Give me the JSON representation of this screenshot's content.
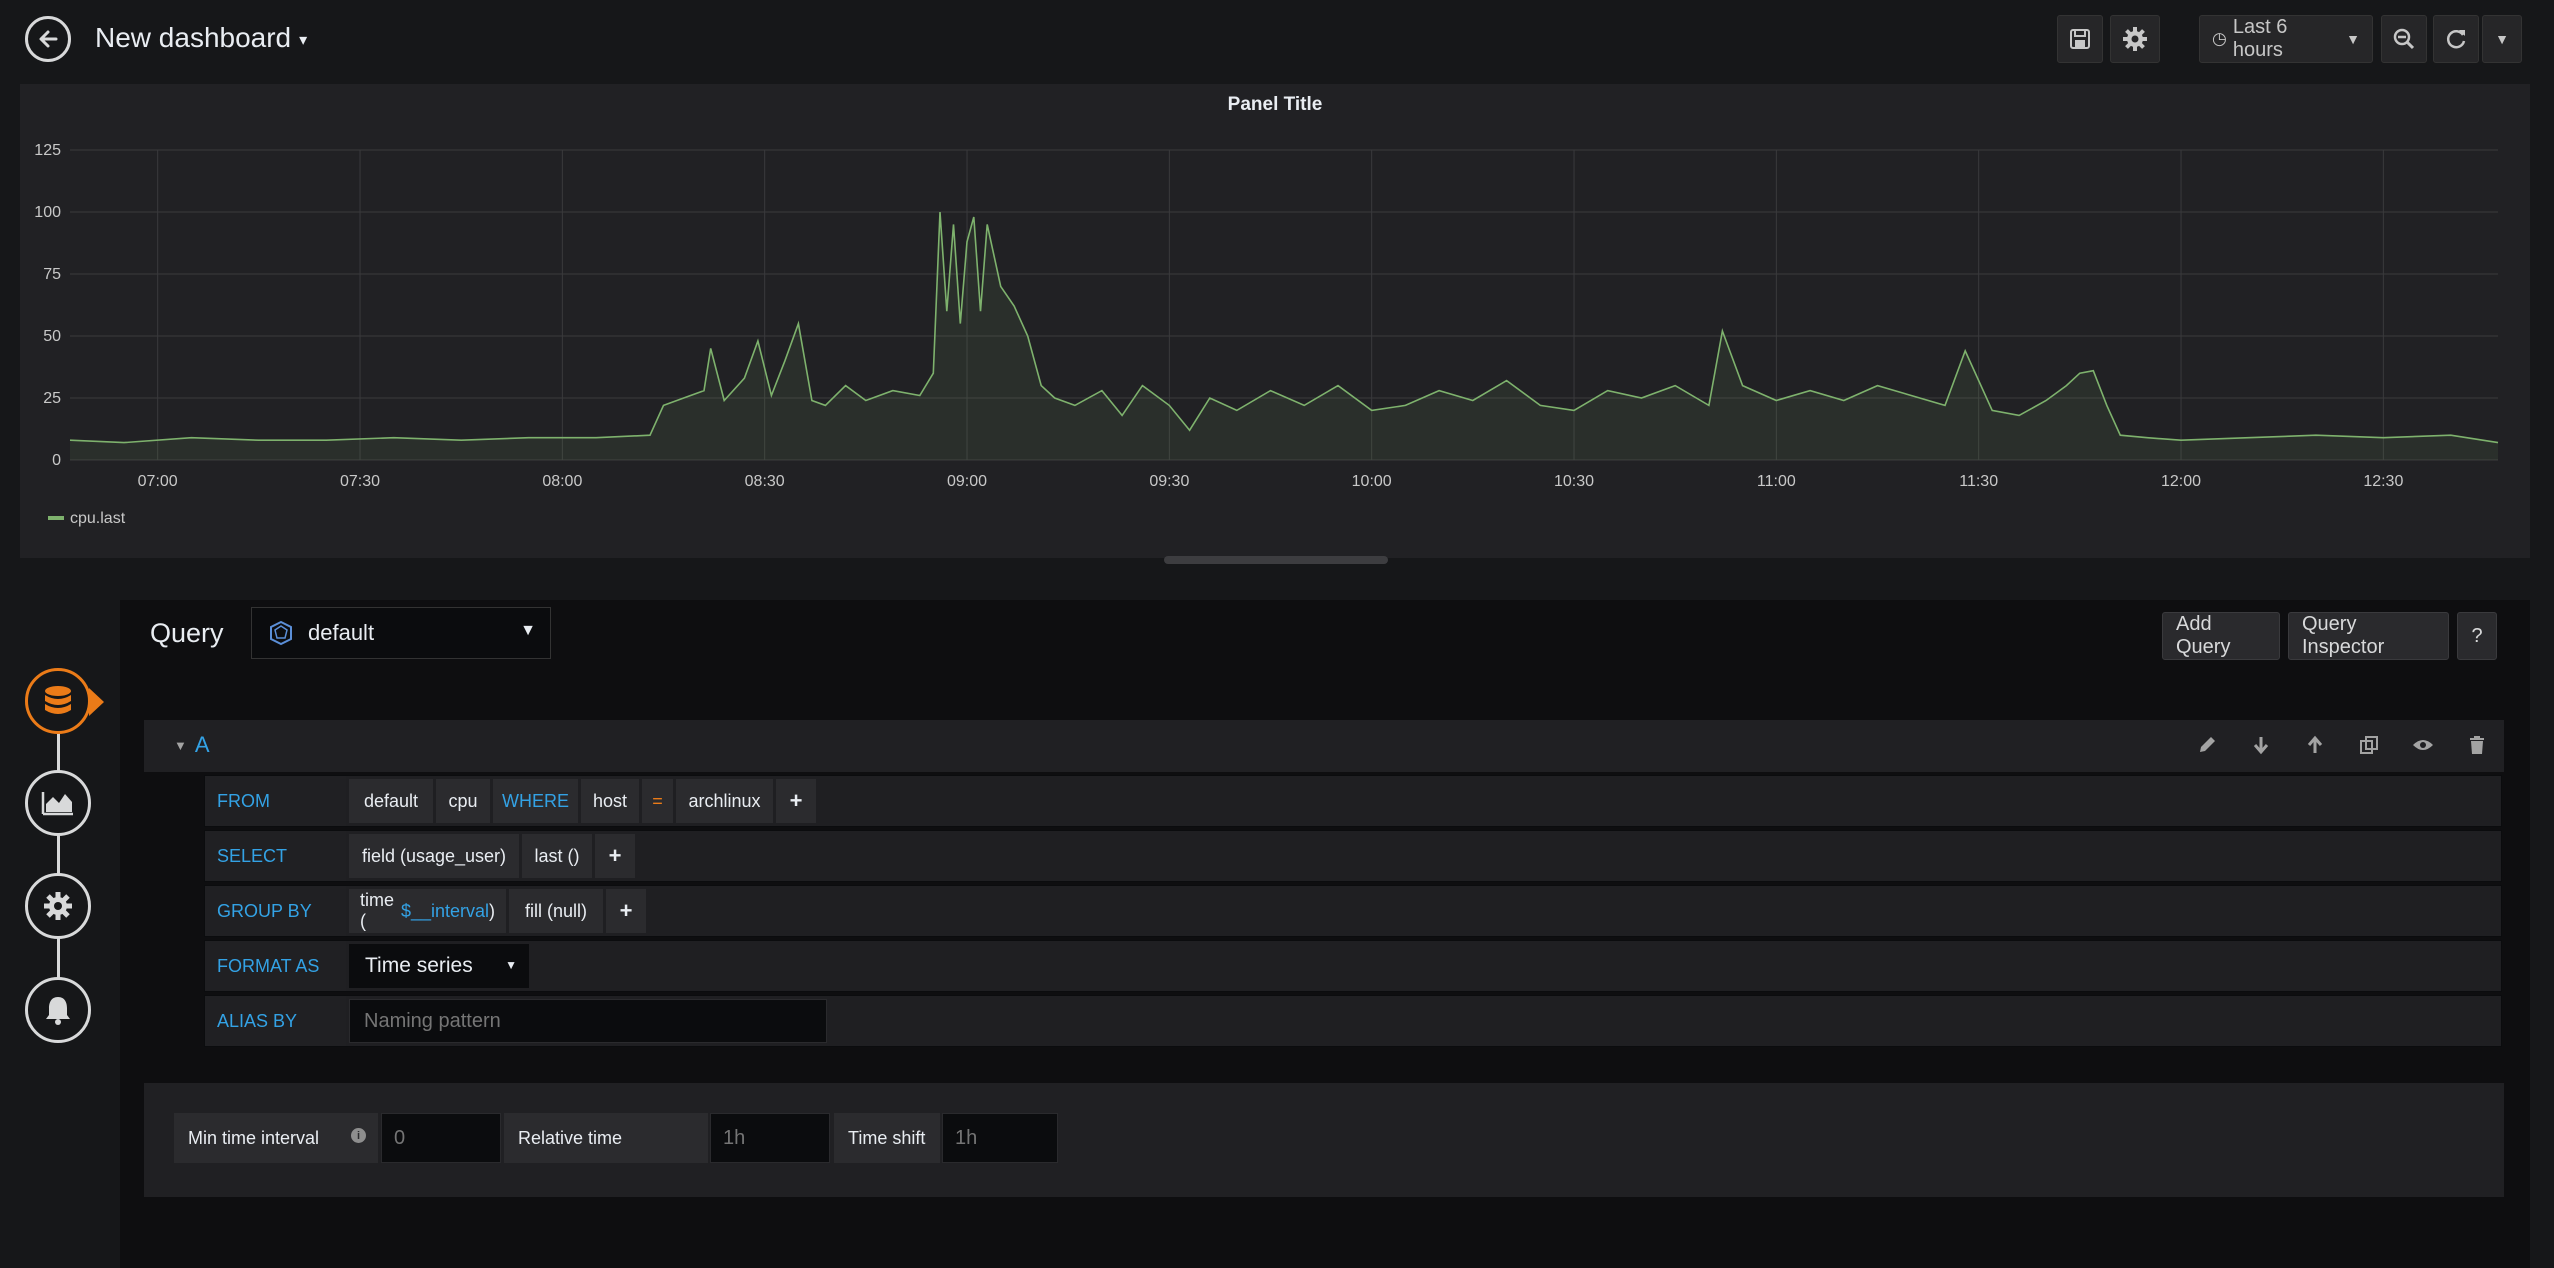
{
  "header": {
    "title": "New dashboard",
    "time_range": "Last 6 hours"
  },
  "panel": {
    "title": "Panel Title",
    "legend": "cpu.last"
  },
  "chart_data": {
    "type": "area",
    "title": "Panel Title",
    "xlabel": "",
    "ylabel": "",
    "x_ticks": [
      "07:00",
      "07:30",
      "08:00",
      "08:30",
      "09:00",
      "09:30",
      "10:00",
      "10:30",
      "11:00",
      "11:30",
      "12:00",
      "12:30"
    ],
    "y_ticks": [
      "125",
      "100",
      "75",
      "50",
      "25",
      "0"
    ],
    "ylim": [
      0,
      125
    ],
    "xlim": [
      "06:47",
      "12:47"
    ],
    "grid": true,
    "legend_position": "bottom-left",
    "series": [
      {
        "name": "cpu.last",
        "color": "#7eb26d",
        "points": [
          [
            "06:47",
            8
          ],
          [
            "06:55",
            7
          ],
          [
            "07:05",
            9
          ],
          [
            "07:15",
            8
          ],
          [
            "07:25",
            8
          ],
          [
            "07:35",
            9
          ],
          [
            "07:45",
            8
          ],
          [
            "07:55",
            9
          ],
          [
            "08:05",
            9
          ],
          [
            "08:13",
            10
          ],
          [
            "08:15",
            22
          ],
          [
            "08:18",
            25
          ],
          [
            "08:21",
            28
          ],
          [
            "08:22",
            45
          ],
          [
            "08:24",
            24
          ],
          [
            "08:27",
            33
          ],
          [
            "08:29",
            48
          ],
          [
            "08:31",
            26
          ],
          [
            "08:33",
            40
          ],
          [
            "08:35",
            55
          ],
          [
            "08:37",
            24
          ],
          [
            "08:39",
            22
          ],
          [
            "08:42",
            30
          ],
          [
            "08:45",
            24
          ],
          [
            "08:49",
            28
          ],
          [
            "08:53",
            26
          ],
          [
            "08:55",
            35
          ],
          [
            "08:56",
            100
          ],
          [
            "08:57",
            60
          ],
          [
            "08:58",
            95
          ],
          [
            "08:59",
            55
          ],
          [
            "09:00",
            88
          ],
          [
            "09:01",
            98
          ],
          [
            "09:02",
            60
          ],
          [
            "09:03",
            95
          ],
          [
            "09:05",
            70
          ],
          [
            "09:07",
            62
          ],
          [
            "09:09",
            50
          ],
          [
            "09:11",
            30
          ],
          [
            "09:13",
            25
          ],
          [
            "09:16",
            22
          ],
          [
            "09:20",
            28
          ],
          [
            "09:23",
            18
          ],
          [
            "09:26",
            30
          ],
          [
            "09:30",
            22
          ],
          [
            "09:33",
            12
          ],
          [
            "09:36",
            25
          ],
          [
            "09:40",
            20
          ],
          [
            "09:45",
            28
          ],
          [
            "09:50",
            22
          ],
          [
            "09:55",
            30
          ],
          [
            "10:00",
            20
          ],
          [
            "10:05",
            22
          ],
          [
            "10:10",
            28
          ],
          [
            "10:15",
            24
          ],
          [
            "10:20",
            32
          ],
          [
            "10:25",
            22
          ],
          [
            "10:30",
            20
          ],
          [
            "10:35",
            28
          ],
          [
            "10:40",
            25
          ],
          [
            "10:45",
            30
          ],
          [
            "10:50",
            22
          ],
          [
            "10:52",
            52
          ],
          [
            "10:55",
            30
          ],
          [
            "11:00",
            24
          ],
          [
            "11:05",
            28
          ],
          [
            "11:10",
            24
          ],
          [
            "11:15",
            30
          ],
          [
            "11:20",
            26
          ],
          [
            "11:25",
            22
          ],
          [
            "11:28",
            44
          ],
          [
            "11:32",
            20
          ],
          [
            "11:36",
            18
          ],
          [
            "11:40",
            24
          ],
          [
            "11:43",
            30
          ],
          [
            "11:45",
            35
          ],
          [
            "11:47",
            36
          ],
          [
            "11:49",
            22
          ],
          [
            "11:51",
            10
          ],
          [
            "11:55",
            9
          ],
          [
            "12:00",
            8
          ],
          [
            "12:10",
            9
          ],
          [
            "12:20",
            10
          ],
          [
            "12:30",
            9
          ],
          [
            "12:40",
            10
          ],
          [
            "12:47",
            7
          ]
        ]
      }
    ]
  },
  "editor": {
    "query_label": "Query",
    "datasource": "default",
    "add_query": "Add Query",
    "query_inspector": "Query Inspector",
    "help": "?",
    "row_letter": "A",
    "from": {
      "keyword": "FROM",
      "policy": "default",
      "measurement": "cpu",
      "where_keyword": "WHERE",
      "tag_key": "host",
      "operator": "=",
      "tag_value": "archlinux"
    },
    "select": {
      "keyword": "SELECT",
      "field": "field (usage_user)",
      "func": "last ()"
    },
    "group_by": {
      "keyword": "GROUP BY",
      "time_prefix": "time (",
      "time_var": "$__interval",
      "time_suffix": ")",
      "fill": "fill (null)"
    },
    "format_as": {
      "keyword": "FORMAT AS",
      "value": "Time series"
    },
    "alias_by": {
      "keyword": "ALIAS BY",
      "placeholder": "Naming pattern"
    },
    "plus": "+"
  },
  "options": {
    "min_interval_label": "Min time interval",
    "min_interval_placeholder": "0",
    "relative_time_label": "Relative time",
    "relative_time_placeholder": "1h",
    "time_shift_label": "Time shift",
    "time_shift_placeholder": "1h"
  }
}
